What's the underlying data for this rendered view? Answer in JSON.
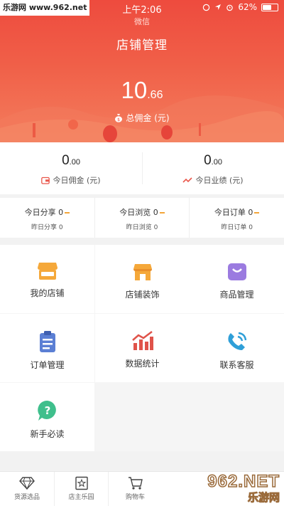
{
  "watermark_top": "乐游网 www.962.net",
  "status_bar": {
    "time": "上午2:06",
    "battery": "62%",
    "battery_level": 0.62,
    "subtitle": "微信"
  },
  "nav": {
    "title": "店铺管理"
  },
  "total": {
    "int": "10",
    "dec": ".66",
    "label": "总佣金 (元)"
  },
  "today": {
    "commission": {
      "int": "0",
      "dec": ".00",
      "label": "今日佣金 (元)"
    },
    "performance": {
      "int": "0",
      "dec": ".00",
      "label": "今日业绩 (元)"
    }
  },
  "stats": [
    {
      "label": "今日分享",
      "value": "0",
      "sub": "昨日分享 0"
    },
    {
      "label": "今日浏览",
      "value": "0",
      "sub": "昨日浏览 0"
    },
    {
      "label": "今日订单",
      "value": "0",
      "sub": "昨日订单 0"
    }
  ],
  "menu": [
    {
      "label": "我的店铺",
      "icon": "store-icon"
    },
    {
      "label": "店铺装饰",
      "icon": "store-decor-icon"
    },
    {
      "label": "商品管理",
      "icon": "bag-icon"
    },
    {
      "label": "订单管理",
      "icon": "clipboard-icon"
    },
    {
      "label": "数据统计",
      "icon": "chart-icon"
    },
    {
      "label": "联系客服",
      "icon": "phone-icon"
    },
    {
      "label": "新手必读",
      "icon": "help-icon"
    }
  ],
  "tabs": [
    {
      "label": "货源选品",
      "icon": "diamond-icon"
    },
    {
      "label": "店主乐园",
      "icon": "star-icon"
    },
    {
      "label": "购物车",
      "icon": "cart-icon"
    }
  ],
  "watermark_bottom": {
    "logo": "962.NET",
    "sub": "乐游网"
  },
  "colors": {
    "header": "#ee4b3e",
    "accent": "#f3a53a"
  }
}
